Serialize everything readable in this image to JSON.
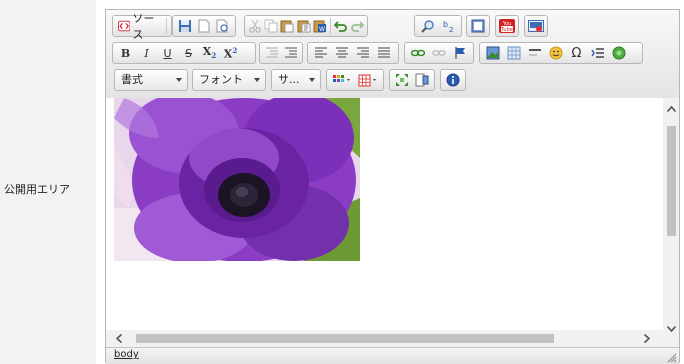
{
  "form": {
    "field_label": "公開用エリア"
  },
  "toolbar": {
    "source_label": "ソース",
    "format_combo": "書式",
    "font_combo": "フォント",
    "size_combo": "サ..."
  },
  "content": {
    "image_subject": "purple anemone flower"
  },
  "statusbar": {
    "element_path": "body"
  },
  "colors": {
    "petal": "#8a3cc4",
    "petal_dark": "#5a1b8f",
    "flower_center": "#1c1424",
    "leaf": "#7aa63e",
    "youtube_red": "#d32020",
    "link_blue": "#2a5db0"
  }
}
